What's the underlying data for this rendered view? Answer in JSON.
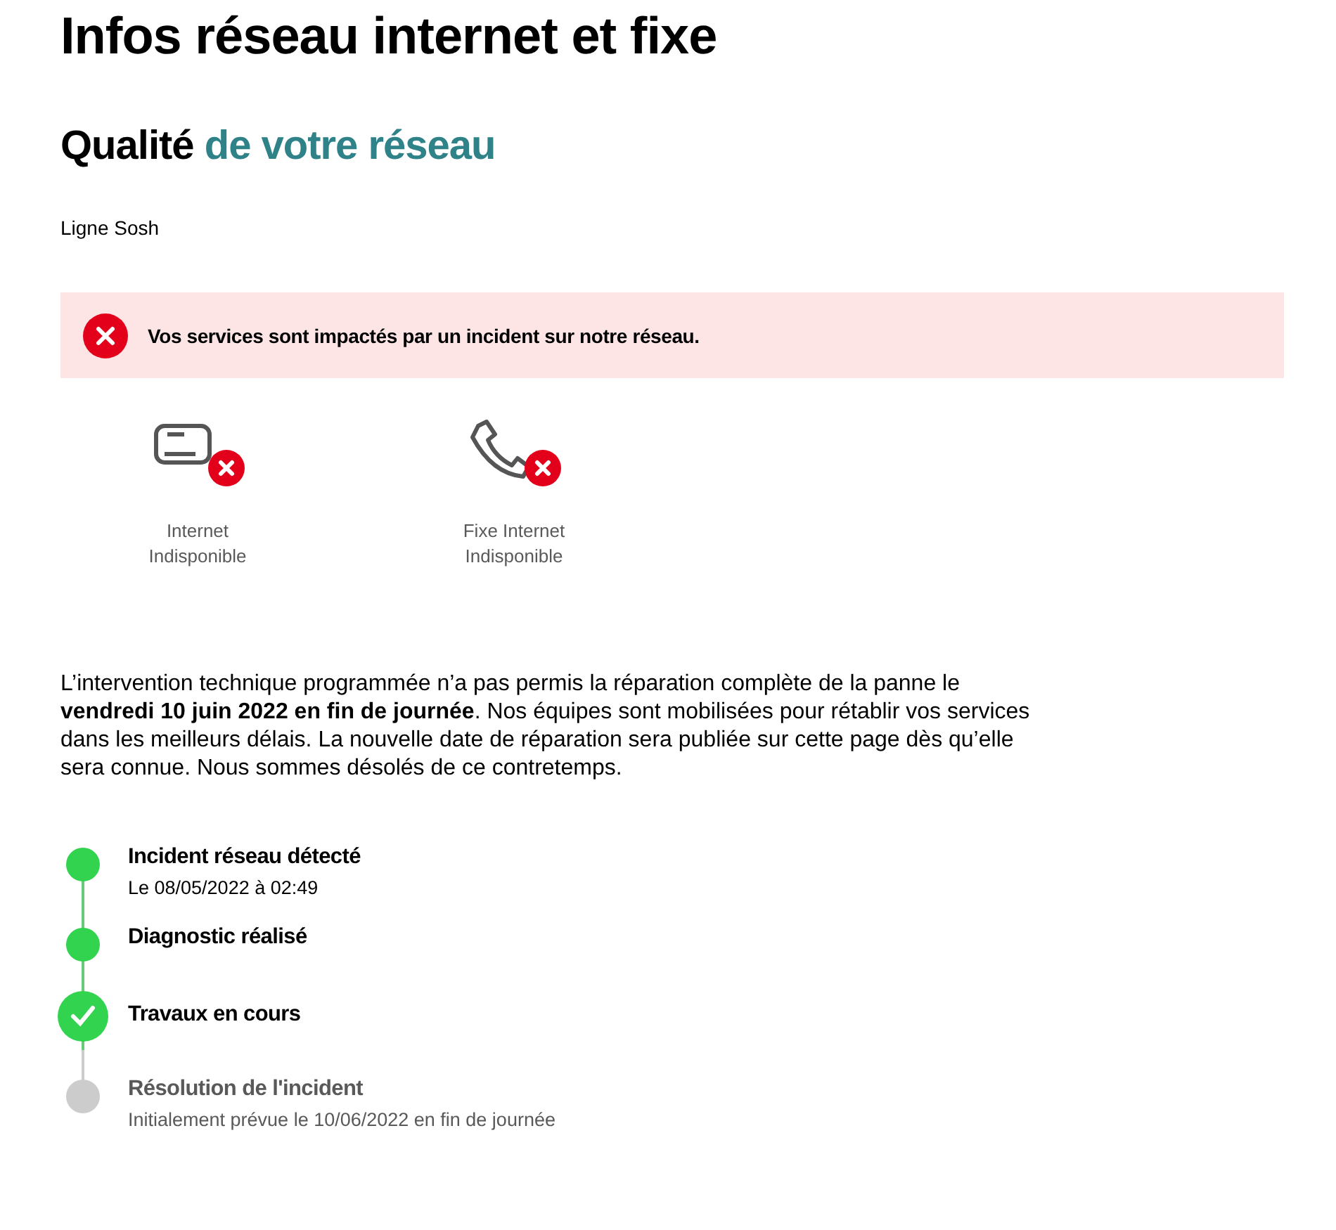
{
  "page_title": "Infos réseau internet et fixe",
  "section_heading": {
    "lead": "Qualité",
    "accent": "de votre réseau"
  },
  "line_label": "Ligne Sosh",
  "alert": {
    "kind": "error",
    "message": "Vos services sont impactés par un incident sur notre réseau."
  },
  "services": [
    {
      "kind": "internet",
      "name": "Internet",
      "status": "Indisponible",
      "available": false
    },
    {
      "kind": "phone",
      "name": "Fixe Internet",
      "status": "Indisponible",
      "available": false
    }
  ],
  "notice": "L’intervention technique programmée n’a pas permis la réparation complète de la panne le **vendredi 10 juin 2022 en fin de journée**. Nos équipes sont mobilisées pour rétablir vos services dans les meilleurs délais. La nouvelle date de réparation sera publiée sur cette page dès qu’elle sera connue. Nous sommes désolés de ce contretemps.",
  "timeline": [
    {
      "title": "Incident réseau détecté",
      "detail": "Le 08/05/2022 à 02:49",
      "done": true,
      "selected": false
    },
    {
      "title": "Diagnostic réalisé",
      "done": true,
      "selected": false
    },
    {
      "title": "Travaux en cours",
      "done": true,
      "selected": true
    },
    {
      "title": "Résolution de l'incident",
      "detail": "Initialement prévue le 10/06/2022 en fin de journée",
      "done": false,
      "selected": false
    }
  ]
}
